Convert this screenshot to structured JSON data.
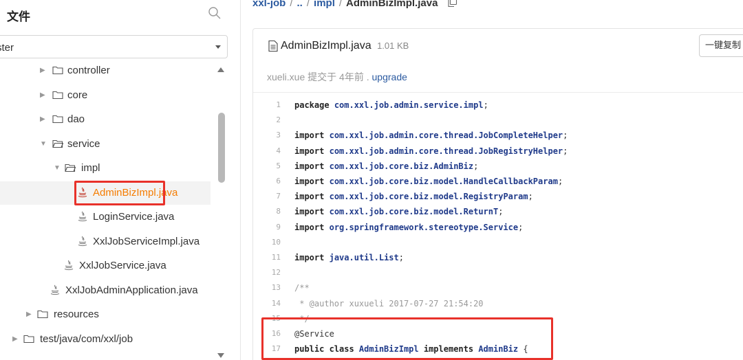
{
  "sidebar": {
    "title": "文件",
    "branch": "ster",
    "tree": [
      {
        "label": "controller",
        "kind": "folder",
        "expanded": false
      },
      {
        "label": "core",
        "kind": "folder",
        "expanded": false
      },
      {
        "label": "dao",
        "kind": "folder",
        "expanded": false
      },
      {
        "label": "service",
        "kind": "folder",
        "expanded": true
      },
      {
        "label": "impl",
        "kind": "folder",
        "expanded": true
      },
      {
        "label": "AdminBizImpl.java",
        "kind": "java",
        "selected": true
      },
      {
        "label": "LoginService.java",
        "kind": "java"
      },
      {
        "label": "XxlJobServiceImpl.java",
        "kind": "java"
      },
      {
        "label": "XxlJobService.java",
        "kind": "java"
      },
      {
        "label": "XxlJobAdminApplication.java",
        "kind": "java"
      },
      {
        "label": "resources",
        "kind": "folder",
        "expanded": false
      },
      {
        "label": "test/java/com/xxl/job",
        "kind": "folder",
        "expanded": false
      }
    ]
  },
  "breadcrumb": {
    "items": [
      "xxl-job",
      "..",
      "impl"
    ],
    "current": "AdminBizImpl.java"
  },
  "file": {
    "name": "AdminBizImpl.java",
    "size": "1.01 KB",
    "copy_label": "一键复制",
    "commit": {
      "author": "xueli.xue",
      "action": "提交于",
      "time": "4年前",
      "separator": ".",
      "message": "upgrade"
    }
  },
  "code": [
    {
      "n": "1",
      "text": "package com.xxl.job.admin.service.impl;"
    },
    {
      "n": "2",
      "text": ""
    },
    {
      "n": "3",
      "text": "import com.xxl.job.admin.core.thread.JobCompleteHelper;"
    },
    {
      "n": "4",
      "text": "import com.xxl.job.admin.core.thread.JobRegistryHelper;"
    },
    {
      "n": "5",
      "text": "import com.xxl.job.core.biz.AdminBiz;"
    },
    {
      "n": "6",
      "text": "import com.xxl.job.core.biz.model.HandleCallbackParam;"
    },
    {
      "n": "7",
      "text": "import com.xxl.job.core.biz.model.RegistryParam;"
    },
    {
      "n": "8",
      "text": "import com.xxl.job.core.biz.model.ReturnT;"
    },
    {
      "n": "9",
      "text": "import org.springframework.stereotype.Service;"
    },
    {
      "n": "10",
      "text": ""
    },
    {
      "n": "11",
      "text": "import java.util.List;"
    },
    {
      "n": "12",
      "text": ""
    },
    {
      "n": "13",
      "text": "/**"
    },
    {
      "n": "14",
      "text": " * @author xuxueli 2017-07-27 21:54:20"
    },
    {
      "n": "15",
      "text": " */"
    },
    {
      "n": "16",
      "text": "@Service"
    },
    {
      "n": "17",
      "text": "public class AdminBizImpl implements AdminBiz {"
    }
  ],
  "colors": {
    "selected_file": "#f57c00",
    "link": "#2b5aa0",
    "highlight_box": "#e8312a"
  }
}
